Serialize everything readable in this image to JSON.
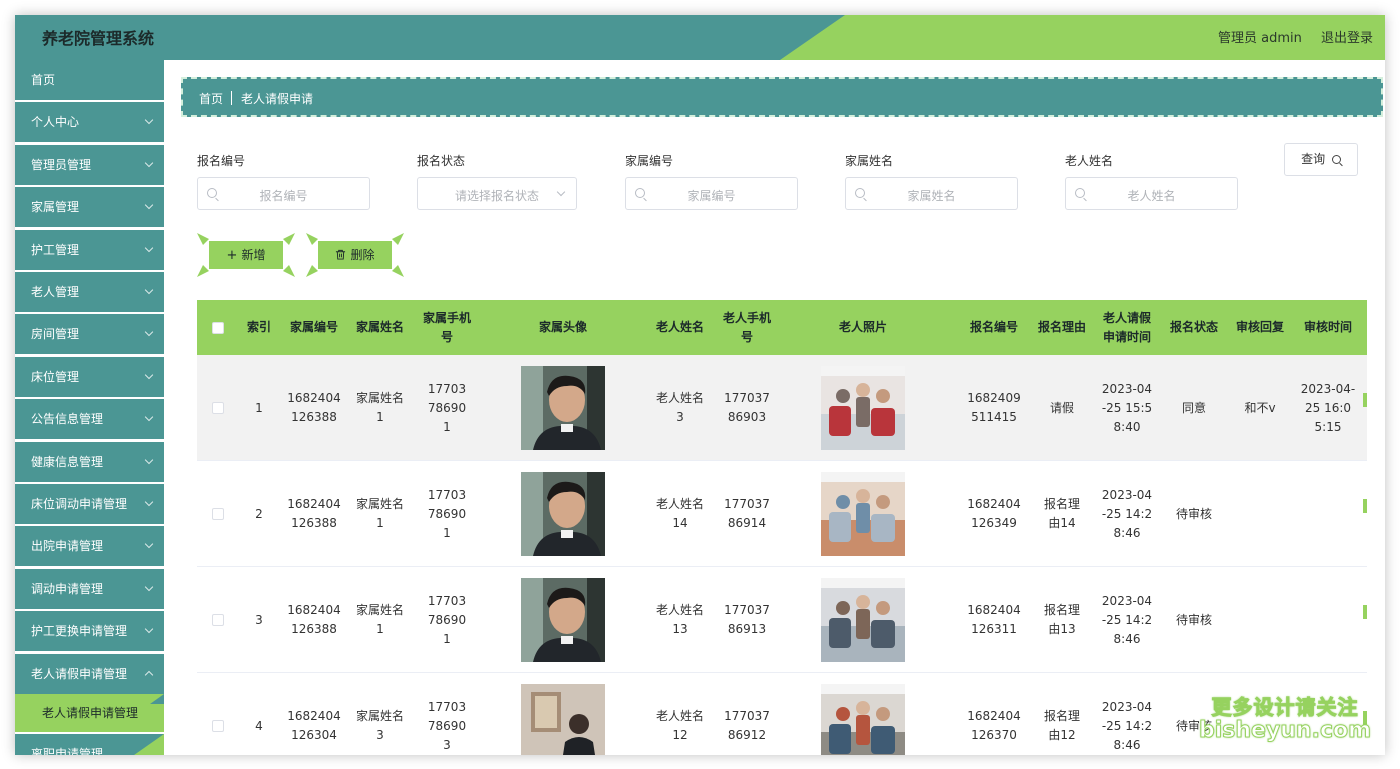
{
  "app": {
    "title": "养老院管理系统",
    "user_label": "管理员 admin",
    "logout_label": "退出登录"
  },
  "colors": {
    "teal": "#4b9694",
    "green": "#96d25f"
  },
  "sidebar": {
    "items": [
      {
        "label": "首页",
        "has_children": false
      },
      {
        "label": "个人中心",
        "has_children": true
      },
      {
        "label": "管理员管理",
        "has_children": true
      },
      {
        "label": "家属管理",
        "has_children": true
      },
      {
        "label": "护工管理",
        "has_children": true
      },
      {
        "label": "老人管理",
        "has_children": true
      },
      {
        "label": "房间管理",
        "has_children": true
      },
      {
        "label": "床位管理",
        "has_children": true
      },
      {
        "label": "公告信息管理",
        "has_children": true
      },
      {
        "label": "健康信息管理",
        "has_children": true
      },
      {
        "label": "床位调动申请管理",
        "has_children": true
      },
      {
        "label": "出院申请管理",
        "has_children": true
      },
      {
        "label": "调动申请管理",
        "has_children": true
      },
      {
        "label": "护工更换申请管理",
        "has_children": true
      },
      {
        "label": "老人请假申请管理",
        "has_children": true,
        "expanded": true
      }
    ],
    "active_sub_label": "老人请假申请管理",
    "cut_item_label": "离职申请管理"
  },
  "breadcrumb": {
    "home": "首页",
    "current": "老人请假申请"
  },
  "filters": {
    "baoming_no": {
      "label": "报名编号",
      "placeholder": "报名编号"
    },
    "baoming_status": {
      "label": "报名状态",
      "placeholder": "请选择报名状态"
    },
    "jiashu_no": {
      "label": "家属编号",
      "placeholder": "家属编号"
    },
    "jiashu_name": {
      "label": "家属姓名",
      "placeholder": "家属姓名"
    },
    "laoren_name": {
      "label": "老人姓名",
      "placeholder": "老人姓名"
    },
    "query_label": "查询"
  },
  "actions": {
    "add_label": "新增",
    "delete_label": "删除"
  },
  "table": {
    "headers": {
      "index": "索引",
      "jiashu_no": "家属编号",
      "jiashu_name": "家属姓名",
      "jiashu_phone": "家属手机号",
      "jiashu_avatar": "家属头像",
      "laoren_name": "老人姓名",
      "laoren_phone": "老人手机号",
      "laoren_photo": "老人照片",
      "baoming_no": "报名编号",
      "reason": "报名理由",
      "apply_time": "老人请假申请时间",
      "status": "报名状态",
      "reply": "审核回复",
      "review_time": "审核时间"
    },
    "rows": [
      {
        "index": "1",
        "jiashu_no": "1682404126388",
        "jiashu_name": "家属姓名1",
        "jiashu_phone": "17703786901",
        "laoren_name": "老人姓名3",
        "laoren_phone": "17703786903",
        "baoming_no": "1682409511415",
        "reason": "请假",
        "apply_time": "2023-04-25 15:58:40",
        "status": "同意",
        "reply": "和不v",
        "review_time": "2023-04-25 16:05:15"
      },
      {
        "index": "2",
        "jiashu_no": "1682404126388",
        "jiashu_name": "家属姓名1",
        "jiashu_phone": "17703786901",
        "laoren_name": "老人姓名14",
        "laoren_phone": "17703786914",
        "baoming_no": "1682404126349",
        "reason": "报名理由14",
        "apply_time": "2023-04-25 14:28:46",
        "status": "待审核",
        "reply": "",
        "review_time": ""
      },
      {
        "index": "3",
        "jiashu_no": "1682404126388",
        "jiashu_name": "家属姓名1",
        "jiashu_phone": "17703786901",
        "laoren_name": "老人姓名13",
        "laoren_phone": "17703786913",
        "baoming_no": "1682404126311",
        "reason": "报名理由13",
        "apply_time": "2023-04-25 14:28:46",
        "status": "待审核",
        "reply": "",
        "review_time": ""
      },
      {
        "index": "4",
        "jiashu_no": "1682404126304",
        "jiashu_name": "家属姓名3",
        "jiashu_phone": "17703786903",
        "laoren_name": "老人姓名12",
        "laoren_phone": "17703786912",
        "baoming_no": "1682404126370",
        "reason": "报名理由12",
        "apply_time": "2023-04-25 14:28:46",
        "status": "待审核",
        "reply": "",
        "review_time": ""
      }
    ]
  },
  "watermark": {
    "line1": "更多设计请关注",
    "line2": "bisheyun.com"
  }
}
